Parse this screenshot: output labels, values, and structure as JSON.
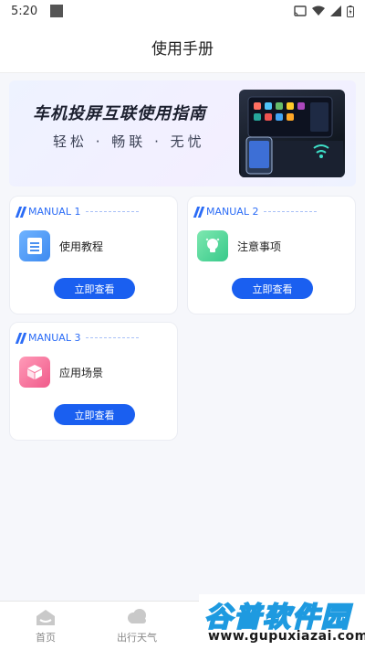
{
  "status_bar": {
    "time": "5:20"
  },
  "header": {
    "title": "使用手册"
  },
  "banner": {
    "title": "车机投屏互联使用指南",
    "subtitle": "轻松 · 畅联 · 无忧"
  },
  "cards": [
    {
      "tag": "MANUAL 1",
      "label": "使用教程",
      "button": "立即查看",
      "icon": "document-icon",
      "color": "#4a90f0"
    },
    {
      "tag": "MANUAL 2",
      "label": "注意事项",
      "button": "立即查看",
      "icon": "lightbulb-icon",
      "color": "#3fcf8e"
    },
    {
      "tag": "MANUAL 3",
      "label": "应用场景",
      "button": "立即查看",
      "icon": "cube-icon",
      "color": "#f06292"
    }
  ],
  "tabs": [
    {
      "label": "首页",
      "icon": "home-icon"
    },
    {
      "label": "出行天气",
      "icon": "weather-icon"
    }
  ],
  "watermark": {
    "title": "谷普软件园",
    "url": "www.gupuxiazai.com"
  },
  "colors": {
    "accent": "#1a5ff0"
  }
}
